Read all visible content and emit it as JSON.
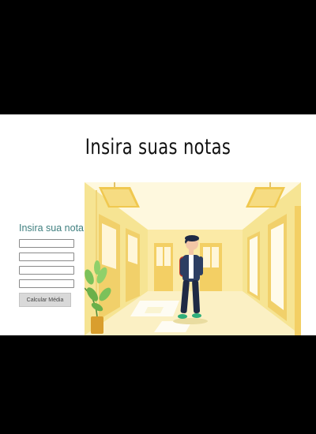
{
  "page": {
    "title": "Insira suas notas"
  },
  "form": {
    "heading": "Insira sua nota",
    "inputs": [
      "",
      "",
      "",
      ""
    ],
    "button_label": "Calcular Média"
  },
  "illustration": {
    "subject": "student-in-school-hallway"
  },
  "colors": {
    "background_outside": "#000000",
    "page_background": "#ffffff",
    "heading_color": "#3f7f7f",
    "hallway_yellow": "#f6e493",
    "hallway_light": "#fdf4cf"
  }
}
